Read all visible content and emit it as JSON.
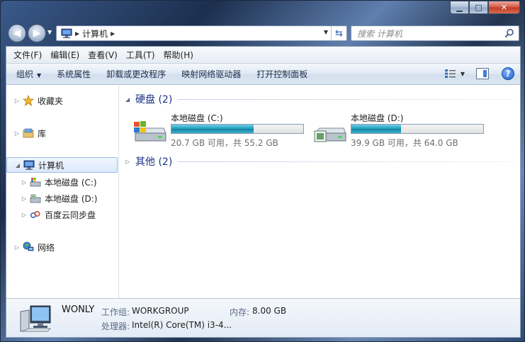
{
  "window": {
    "caption": {
      "minimize": "▁",
      "maximize": "□",
      "close": "✕"
    }
  },
  "address": {
    "location": "计算机",
    "search_placeholder": "搜索 计算机"
  },
  "menu": [
    "文件(F)",
    "编辑(E)",
    "查看(V)",
    "工具(T)",
    "帮助(H)"
  ],
  "commands": {
    "organize": "组织",
    "items": [
      "系统属性",
      "卸载或更改程序",
      "映射网络驱动器",
      "打开控制面板"
    ]
  },
  "nav_tree": {
    "favorites": "收藏夹",
    "libraries": "库",
    "computer": "计算机",
    "drive_c": "本地磁盘 (C:)",
    "drive_d": "本地磁盘 (D:)",
    "baidu": "百度云同步盘",
    "network": "网络"
  },
  "groups": {
    "hard_disks": "硬盘 (2)",
    "other": "其他 (2)"
  },
  "drives": [
    {
      "name": "本地磁盘 (C:)",
      "free_text": "20.7 GB 可用，共 55.2 GB",
      "used_fraction": 0.625
    },
    {
      "name": "本地磁盘 (D:)",
      "free_text": "39.9 GB 可用，共 64.0 GB",
      "used_fraction": 0.377
    }
  ],
  "details": {
    "computer_name": "WONLY",
    "workgroup_label": "工作组:",
    "workgroup_value": "WORKGROUP",
    "memory_label": "内存:",
    "memory_value": "8.00 GB",
    "cpu_label": "处理器:",
    "cpu_value": "Intel(R) Core(TM) i3-4..."
  },
  "colors": {
    "accent": "#1e3287",
    "drive_bar": "#1d9bbd"
  }
}
